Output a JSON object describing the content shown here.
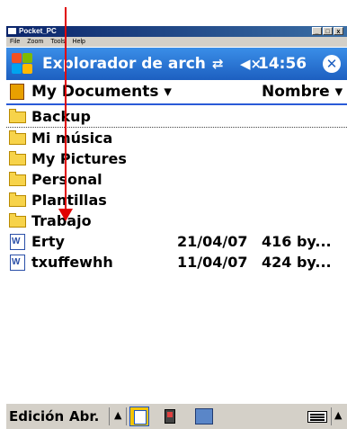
{
  "window": {
    "title": "Pocket_PC",
    "menu": [
      "File",
      "Zoom",
      "Tools",
      "Help"
    ],
    "controls": [
      "_",
      "□",
      "x"
    ]
  },
  "titlebar": {
    "app_title": "Explorador de arch",
    "connectivity_icon": "connectivity-icon",
    "volume_icon": "volume-muted-icon",
    "volume_symbol": "◀×",
    "time": "14:56",
    "close_icon": "close-icon"
  },
  "header": {
    "folder": "My Documents",
    "sort": "Nombre",
    "dropdown_icon": "▾"
  },
  "items": [
    {
      "type": "folder",
      "name": "Backup"
    },
    {
      "type": "folder",
      "name": "Mi música"
    },
    {
      "type": "folder",
      "name": "My Pictures"
    },
    {
      "type": "folder",
      "name": "Personal"
    },
    {
      "type": "folder",
      "name": "Plantillas"
    },
    {
      "type": "folder",
      "name": "Trabajo"
    },
    {
      "type": "file",
      "name": "Erty",
      "date": "21/04/07",
      "size": "416 by..."
    },
    {
      "type": "file",
      "name": "txuffewhh",
      "date": "11/04/07",
      "size": "424 by..."
    }
  ],
  "bottom": {
    "menu1": "Edición",
    "menu2": "Abr.",
    "up_arrow": "▲"
  },
  "colors": {
    "titlebar": "#1d5fc0",
    "selection_line": "#2a5bd7",
    "arrow": "#e00000",
    "folder": "#f7d34a"
  }
}
